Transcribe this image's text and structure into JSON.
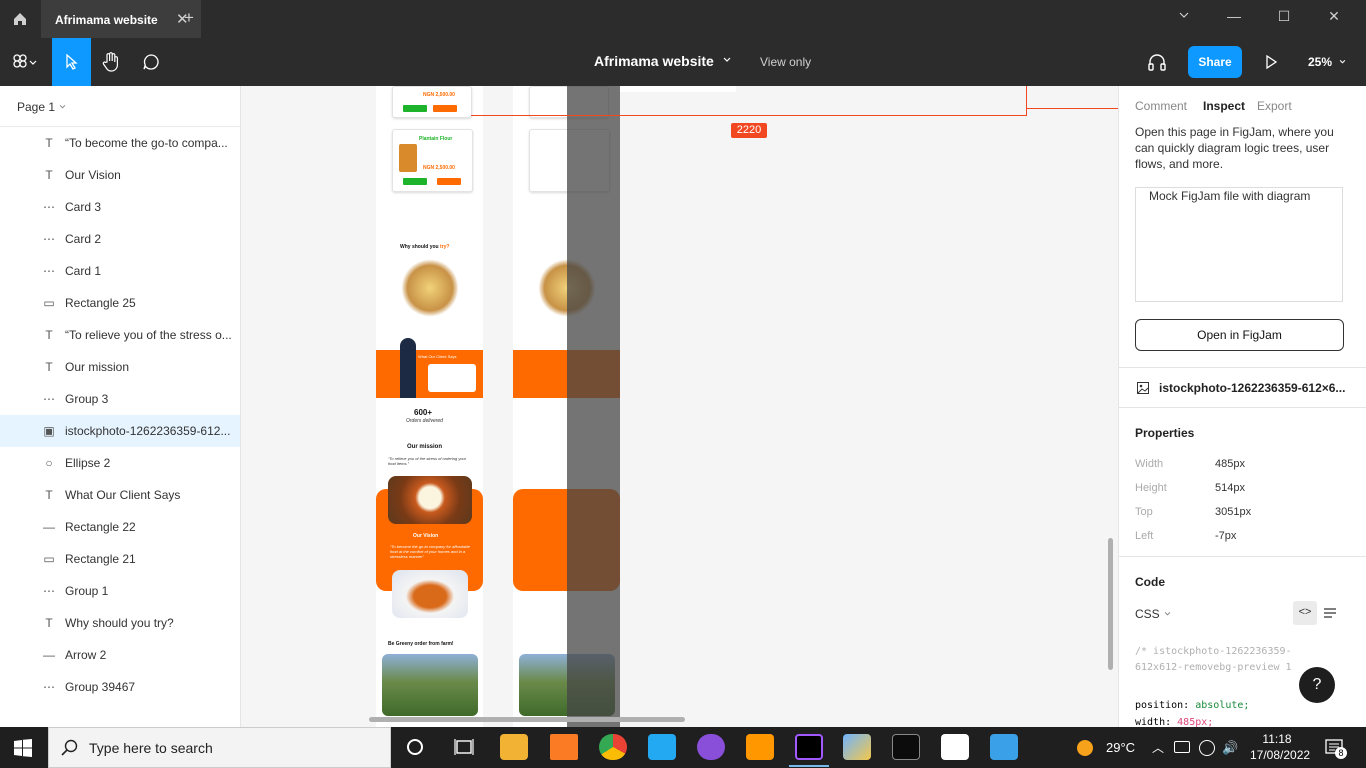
{
  "tab": {
    "title": "Afrimama website"
  },
  "toolbar": {
    "doc_title": "Afrimama website",
    "view_mode": "View only",
    "share_label": "Share",
    "zoom": "25%"
  },
  "left_panel": {
    "page": "Page 1",
    "layers": [
      {
        "type": "text",
        "label": "“To become the go-to compa..."
      },
      {
        "type": "text",
        "label": "Our Vision"
      },
      {
        "type": "frame",
        "label": "Card 3"
      },
      {
        "type": "frame",
        "label": "Card 2"
      },
      {
        "type": "frame",
        "label": "Card 1"
      },
      {
        "type": "rect",
        "label": "Rectangle 25"
      },
      {
        "type": "text",
        "label": "“To relieve you of the stress o..."
      },
      {
        "type": "text",
        "label": "Our mission"
      },
      {
        "type": "frame",
        "label": "Group 3"
      },
      {
        "type": "image",
        "label": "istockphoto-1262236359-612...",
        "selected": true
      },
      {
        "type": "ellipse",
        "label": "Ellipse 2"
      },
      {
        "type": "text",
        "label": "What Our Client Says"
      },
      {
        "type": "line",
        "label": "Rectangle 22"
      },
      {
        "type": "rect",
        "label": "Rectangle 21"
      },
      {
        "type": "frame",
        "label": "Group 1"
      },
      {
        "type": "text",
        "label": "Why should you try?"
      },
      {
        "type": "line",
        "label": "Arrow 2"
      },
      {
        "type": "frame",
        "label": "Group 39467"
      }
    ]
  },
  "canvas": {
    "measure": "2220",
    "design": {
      "price": "NGN 2,500.00",
      "add_to_cart": "Add to cart",
      "checkout": "Checkout",
      "product": "Plantain Flour",
      "why": "Why should you",
      "why_accent": "try?",
      "fresh": "Fresh from farm",
      "free": "Free delivery!",
      "clients": "What Our Client Says",
      "orders": "600+",
      "orders_label": "Orders delivered",
      "mission": "Our mission",
      "mission_text": "“To relieve you of the stress of ordering your food items.”",
      "vision": "Our Vision",
      "vision_text": "“To become the go-to company for affordable food at the comfort of your homes and in a stressless manner”",
      "greeny": "Be Greeny order from farm!"
    }
  },
  "right_panel": {
    "tabs": [
      "Comment",
      "Inspect",
      "Export"
    ],
    "active_tab": "Inspect",
    "figjam_text": "Open this page in FigJam, where you can quickly diagram logic trees, user flows, and more.",
    "figjam_img_alt": "Mock FigJam file with diagram",
    "open_figjam": "Open in FigJam",
    "layer_name": "istockphoto-1262236359-612×6...",
    "properties_title": "Properties",
    "properties": [
      {
        "key": "Width",
        "value": "485px"
      },
      {
        "key": "Height",
        "value": "514px"
      },
      {
        "key": "Top",
        "value": "3051px"
      },
      {
        "key": "Left",
        "value": "-7px"
      }
    ],
    "code_title": "Code",
    "code_lang": "CSS",
    "code_comment_1": "/* istockphoto-1262236359-",
    "code_comment_2": "612x612-removebg-preview 1",
    "code_line_1_prop": "position:",
    "code_line_1_val": "absolute;",
    "code_line_2_prop": "width:",
    "code_line_2_val": "485px;"
  },
  "taskbar": {
    "search_placeholder": "Type here to search",
    "temperature": "29°C",
    "time": "11:18",
    "date": "17/08/2022",
    "notifications": "8"
  },
  "colors": {
    "accent": "#0d99ff",
    "brand_orange": "#ff6a00",
    "brand_green": "#1db32a",
    "measure_red": "#f24822"
  }
}
